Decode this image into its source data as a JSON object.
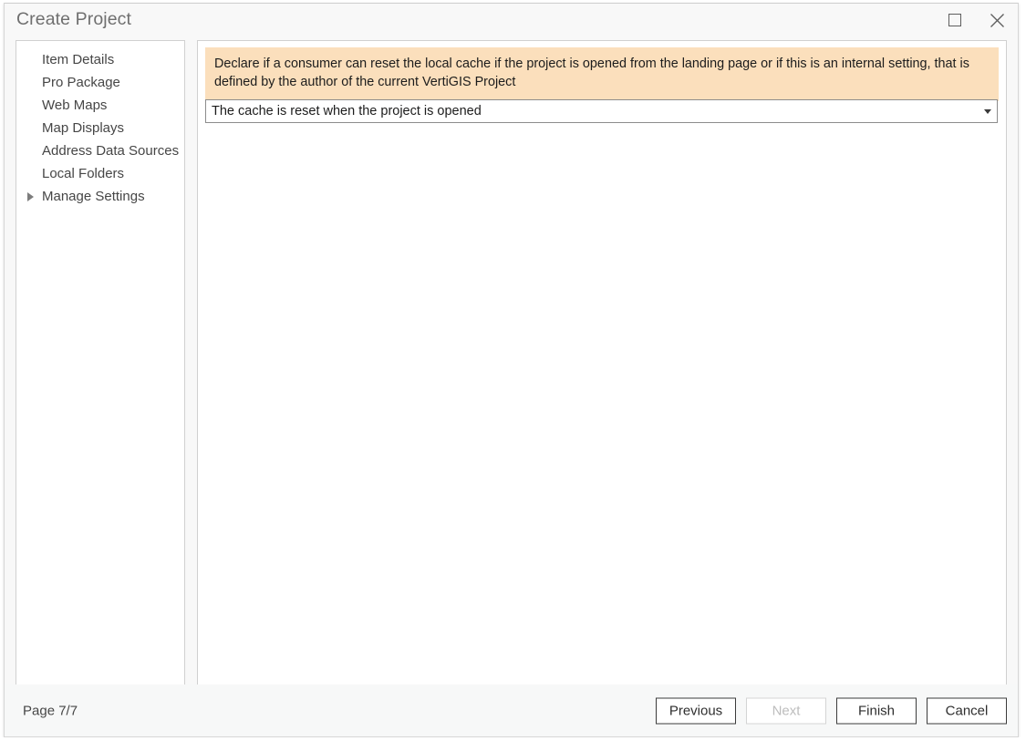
{
  "window": {
    "title": "Create Project",
    "controls": [
      {
        "name": "maximize",
        "icon": "maximize-icon"
      },
      {
        "name": "close",
        "icon": "close-icon"
      }
    ]
  },
  "sidebar": {
    "items": [
      {
        "label": "Item Details",
        "selected": false
      },
      {
        "label": "Pro Package",
        "selected": false
      },
      {
        "label": "Web Maps",
        "selected": false
      },
      {
        "label": "Map Displays",
        "selected": false
      },
      {
        "label": "Address Data Sources",
        "selected": false
      },
      {
        "label": "Local Folders",
        "selected": false
      },
      {
        "label": "Manage Settings",
        "selected": true
      }
    ]
  },
  "content": {
    "banner": {
      "text": "Declare if a consumer can reset the local cache if the project is opened from the landing page or if this is an internal setting, that is defined by the author of the current VertiGIS Project",
      "background_color": "#fbdfbc"
    },
    "cache_setting_dropdown": {
      "value": "The cache is reset when the project is opened",
      "arrow_icon": "chevron-down-icon"
    }
  },
  "footer": {
    "page_label": "Page 7/7",
    "buttons": [
      {
        "label": "Previous",
        "disabled": false
      },
      {
        "label": "Next",
        "disabled": true
      },
      {
        "label": "Finish",
        "disabled": false
      },
      {
        "label": "Cancel",
        "disabled": false
      }
    ]
  }
}
